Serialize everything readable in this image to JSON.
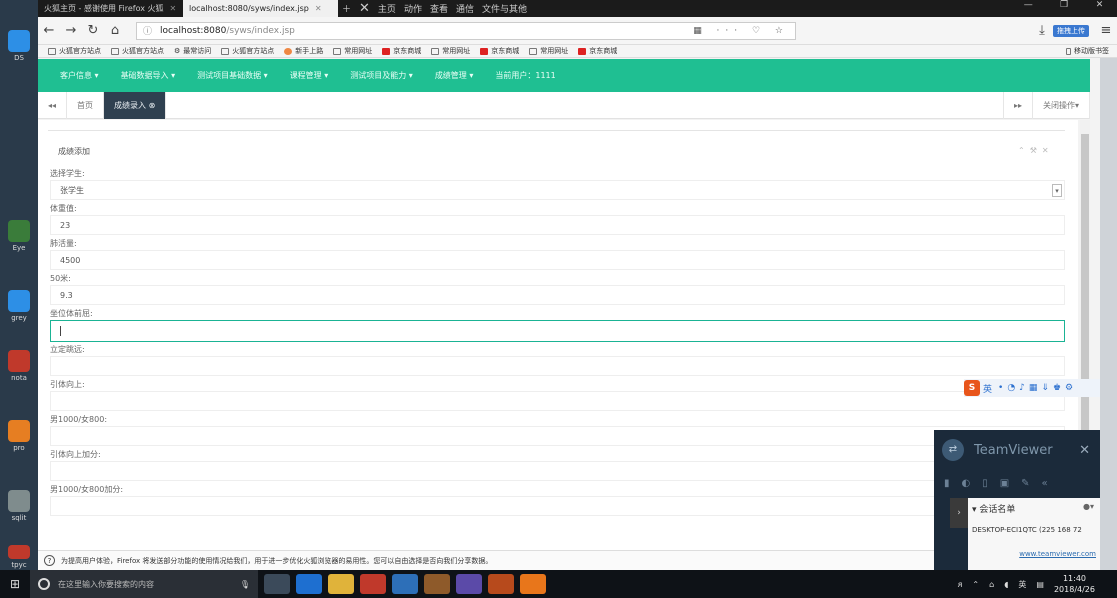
{
  "browser": {
    "tabs": [
      {
        "label": "火狐主页 - 感谢使用 Firefox 火狐",
        "active": false
      },
      {
        "label": "localhost:8080/syws/index.jsp",
        "active": true
      }
    ],
    "toolbar_items": [
      "主页",
      "动作",
      "查看",
      "通信",
      "文件与其他"
    ],
    "url_host": "localhost:8080",
    "url_path": "/syws/index.jsp",
    "bookmarks": [
      "火狐官方站点",
      "火狐官方站点",
      "最常访问",
      "火狐官方站点",
      "新手上路",
      "常用网址",
      "京东商城",
      "常用网址",
      "京东商城",
      "常用网址",
      "京东商城"
    ],
    "bookmark_mobile": "移动版书签",
    "upload_btn": "拖拽上传"
  },
  "app": {
    "menus": [
      "客户信息",
      "基础数据导入",
      "测试项目基础数据",
      "课程管理",
      "测试项目及能力",
      "成绩管理",
      "当前用户：1111"
    ],
    "tabs": [
      {
        "label": "首页",
        "active": false
      },
      {
        "label": "成绩录入",
        "active": true
      }
    ],
    "tabs_right": "关闭操作",
    "panel_title": "成绩添加",
    "fields": [
      {
        "label": "选择学生:",
        "value": "张学生",
        "select": true
      },
      {
        "label": "体重值:",
        "value": "23"
      },
      {
        "label": "肺活量:",
        "value": "4500"
      },
      {
        "label": "50米:",
        "value": "9.3"
      },
      {
        "label": "坐位体前屈:",
        "value": "",
        "focus": true
      },
      {
        "label": "立定跳远:",
        "value": ""
      },
      {
        "label": "引体向上:",
        "value": ""
      },
      {
        "label": "男1000/女800:",
        "value": ""
      },
      {
        "label": "引体向上加分:",
        "value": ""
      },
      {
        "label": "男1000/女800加分:",
        "value": ""
      }
    ],
    "notice": "为提高用户体验，Firefox 将发送部分功能的使用情况给我们，用于进一步优化火狐浏览器的易用性。您可以自由选择是否向我们分享数据。"
  },
  "ime": {
    "label": "英"
  },
  "teamviewer": {
    "title": "TeamViewer",
    "list_header": "会话名单",
    "device": "DESKTOP-ECI1QTC (225 168 72",
    "link": "www.teamviewer.com"
  },
  "taskbar": {
    "search_placeholder": "在这里输入你要搜索的内容",
    "time": "11:40",
    "date": "2018/4/26",
    "lang": "英"
  },
  "desktop_icons": [
    "DS",
    "Eye",
    "grey",
    "nota",
    "pro",
    "sqlit",
    "tpyc"
  ]
}
